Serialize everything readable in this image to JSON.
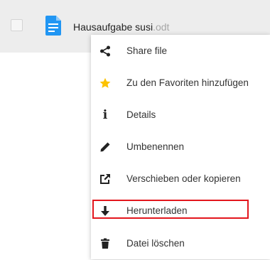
{
  "file": {
    "name": "Hausaufgabe susi",
    "extension": ".odt"
  },
  "menu": {
    "items": [
      {
        "label": "Share file",
        "icon": "share-icon"
      },
      {
        "label": "Zu den Favoriten hinzufügen",
        "icon": "star-icon"
      },
      {
        "label": "Details",
        "icon": "info-icon"
      },
      {
        "label": "Umbenennen",
        "icon": "pencil-icon"
      },
      {
        "label": "Verschieben oder kopieren",
        "icon": "external-link-icon"
      },
      {
        "label": "Herunterladen",
        "icon": "download-icon"
      },
      {
        "label": "Datei löschen",
        "icon": "trash-icon"
      }
    ]
  },
  "colors": {
    "row_background": "#ededed",
    "file_icon": "#2196f3",
    "star": "#fcc200",
    "highlight_border": "#e3161d"
  }
}
